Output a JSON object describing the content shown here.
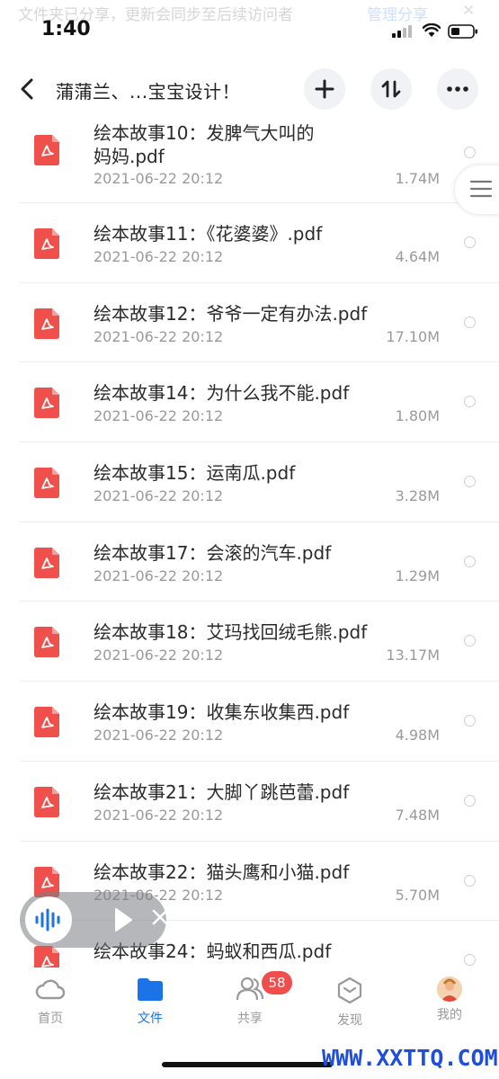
{
  "banner": {
    "message": "文件夹已分享，更新会同步至后续访问者",
    "manage": "管理分享"
  },
  "status_bar": {
    "time": "1:40"
  },
  "navbar": {
    "title": "蒲蒲兰、...宝宝设计！"
  },
  "files": [
    {
      "name_line1": "绘本故事10：发脾气大叫的",
      "name_line2": "妈妈.pdf",
      "date": "2021-06-22 20:12",
      "size": "1.74M"
    },
    {
      "name_line1": "绘本故事11：《花婆婆》.pdf",
      "date": "2021-06-22 20:12",
      "size": "4.64M"
    },
    {
      "name_line1": "绘本故事12：爷爷一定有办法.pdf",
      "date": "2021-06-22 20:12",
      "size": "17.10M"
    },
    {
      "name_line1": "绘本故事14：为什么我不能.pdf",
      "date": "2021-06-22 20:12",
      "size": "1.80M"
    },
    {
      "name_line1": "绘本故事15：运南瓜.pdf",
      "date": "2021-06-22 20:12",
      "size": "3.28M"
    },
    {
      "name_line1": "绘本故事17：会滚的汽车.pdf",
      "date": "2021-06-22 20:12",
      "size": "1.29M"
    },
    {
      "name_line1": "绘本故事18：艾玛找回绒毛熊.pdf",
      "date": "2021-06-22 20:12",
      "size": "13.17M"
    },
    {
      "name_line1": "绘本故事19：收集东收集西.pdf",
      "date": "2021-06-22 20:12",
      "size": "4.98M"
    },
    {
      "name_line1": "绘本故事21：大脚丫跳芭蕾.pdf",
      "date": "2021-06-22 20:12",
      "size": "7.48M"
    },
    {
      "name_line1": "绘本故事22：猫头鹰和小猫.pdf",
      "date": "2021-06-22 20:12",
      "size": "5.70M"
    },
    {
      "name_line1": "绘本故事24：蚂蚁和西瓜.pdf",
      "date": "",
      "size": ""
    }
  ],
  "tabbar": {
    "home": "首页",
    "files": "文件",
    "share": "共享",
    "discover": "发现",
    "mine": "我的",
    "share_badge": "58"
  },
  "colors": {
    "accent": "#1a73e8",
    "pdf_red": "#f0504c",
    "badge": "#f04d4d"
  },
  "watermark": "WWW.XXTTQ.COM"
}
